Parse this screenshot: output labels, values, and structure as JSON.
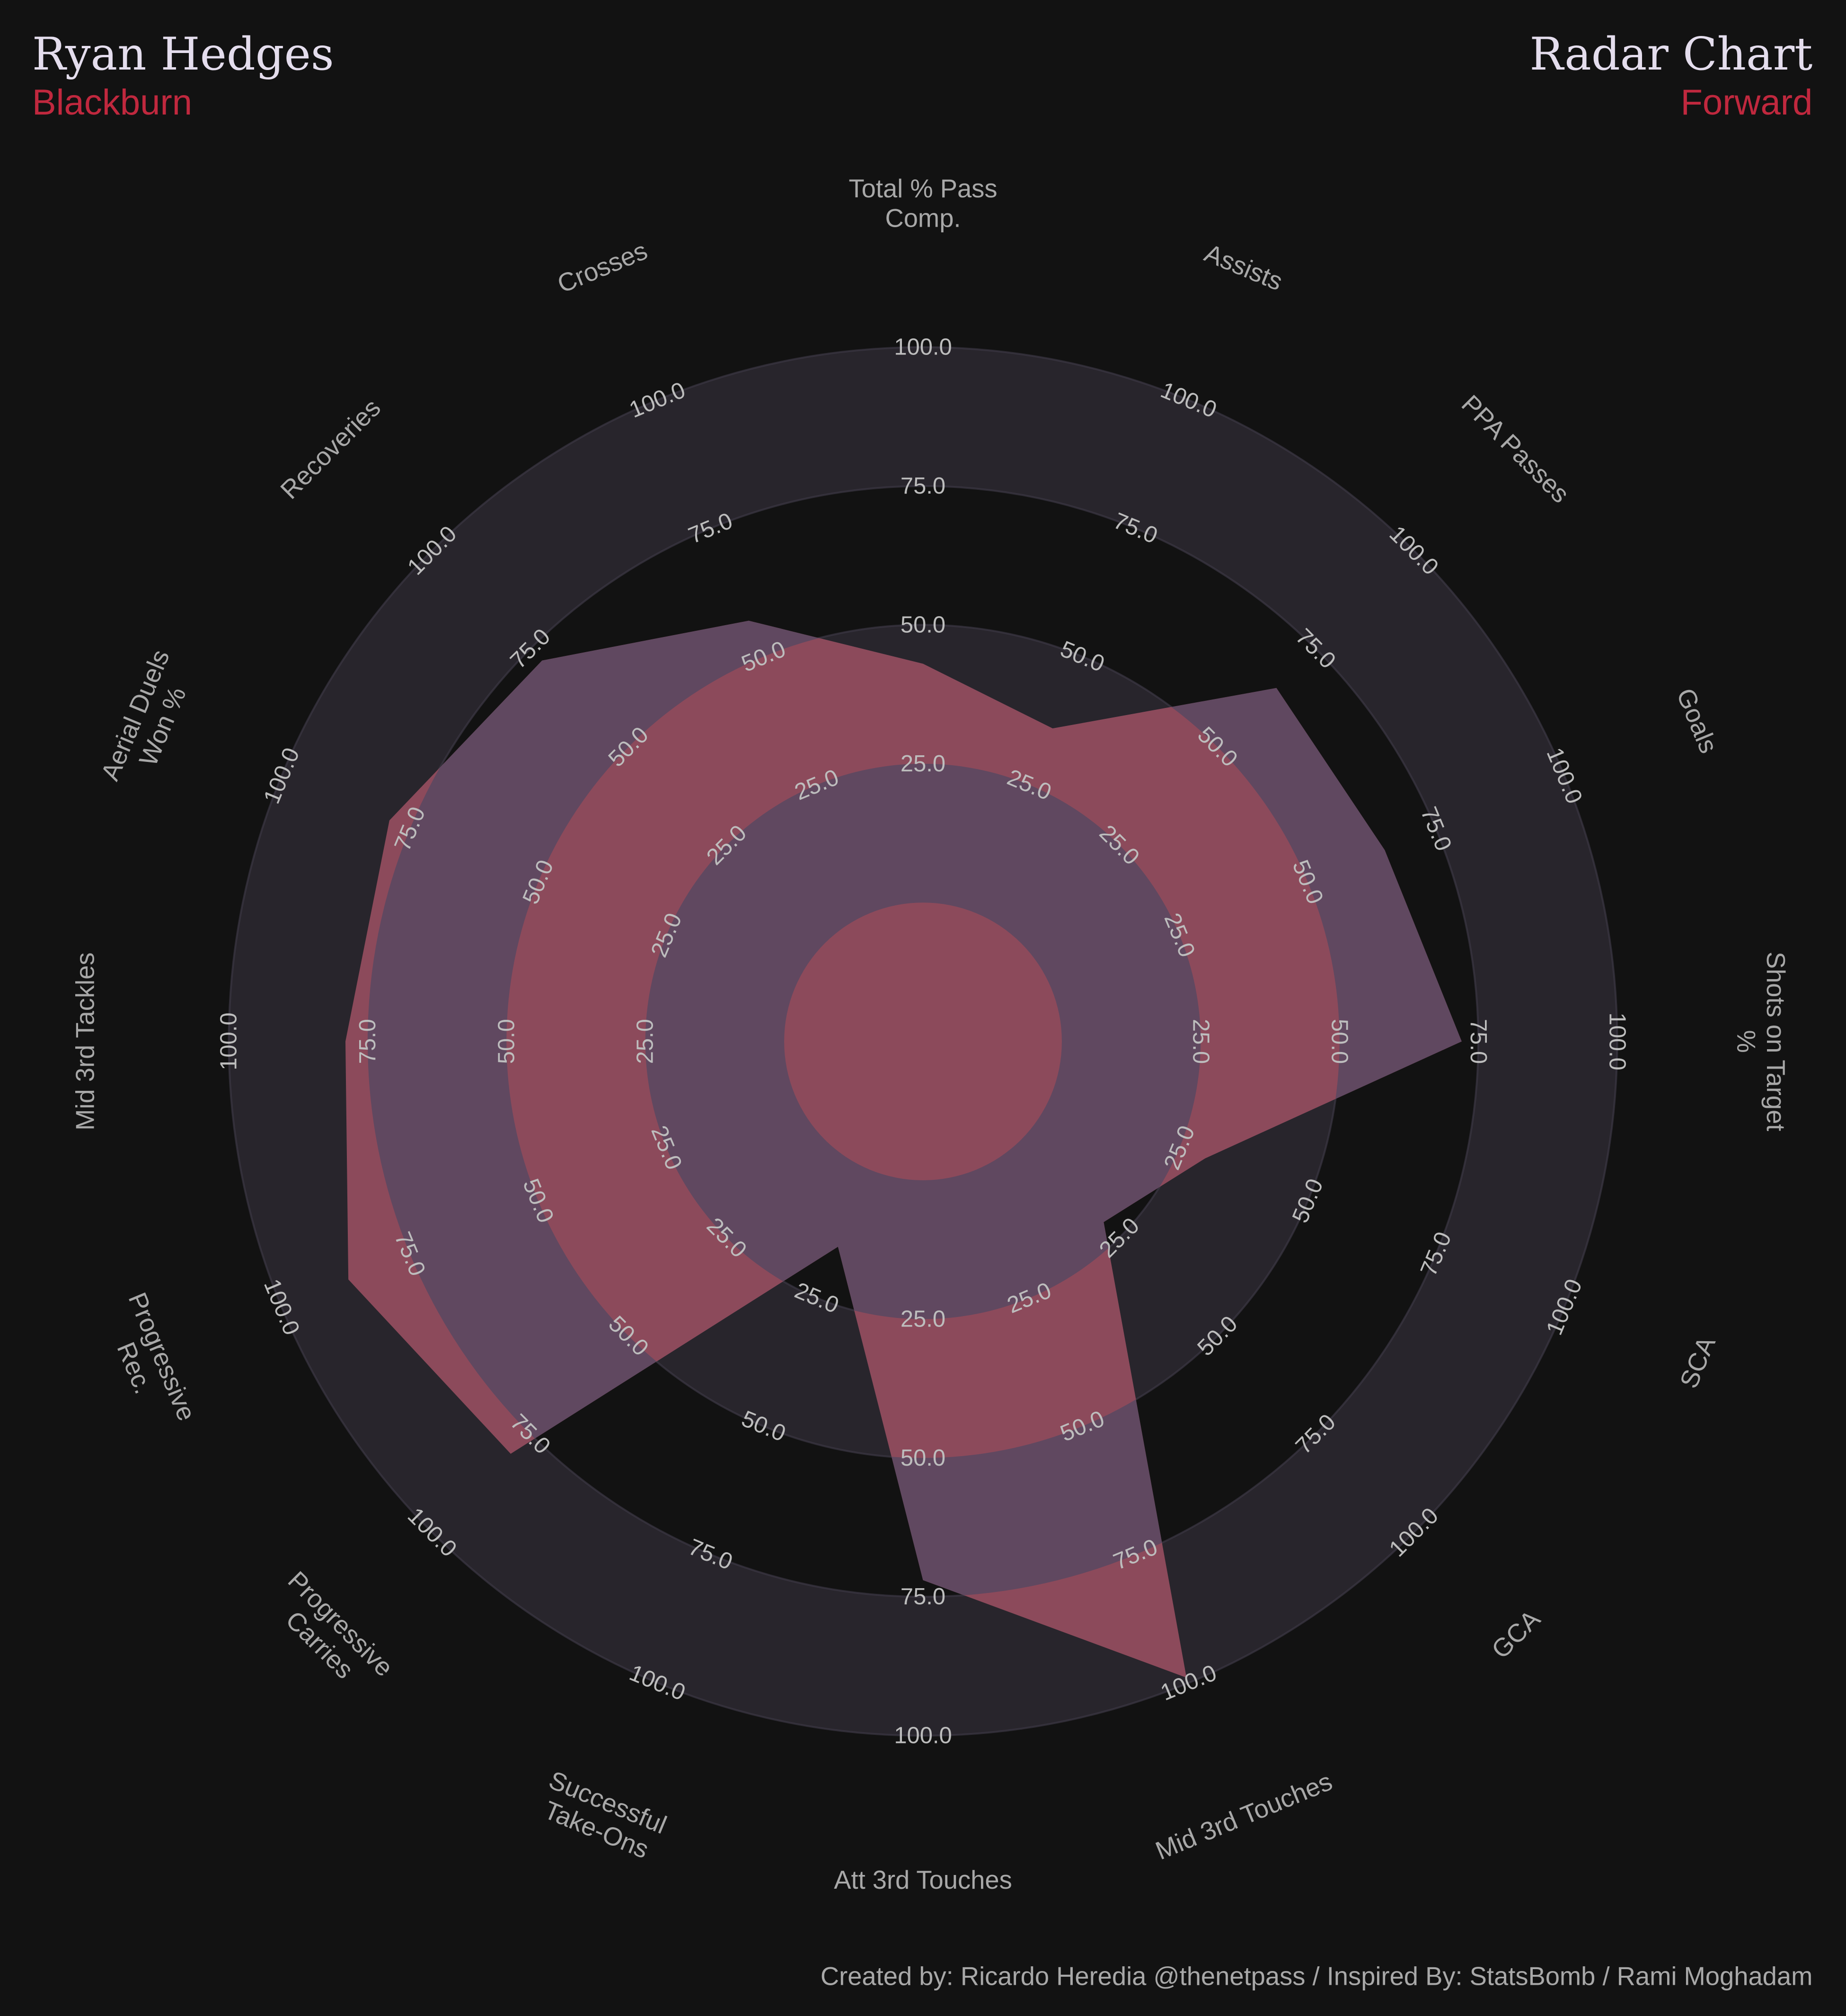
{
  "header": {
    "player": "Ryan Hedges",
    "team": "Blackburn",
    "chart_title": "Radar Chart",
    "position": "Forward"
  },
  "footer": "Created by: Ricardo Heredia @thenetpass / Inspired By: StatsBomb / Rami Moghadam",
  "colors": {
    "background": "#121212",
    "ring": "#28252c",
    "fill_a": "#8c4a5b",
    "fill_b": "#604860",
    "accent": "#c0283e"
  },
  "chart_data": {
    "type": "radar",
    "title": "Radar Chart",
    "params": [
      [
        "Total % Pass",
        "Comp."
      ],
      [
        "Assists"
      ],
      [
        "PPA Passes"
      ],
      [
        "Goals"
      ],
      [
        "Shots on Target",
        "%"
      ],
      [
        "SCA"
      ],
      [
        "GCA"
      ],
      [
        "Mid 3rd Touches"
      ],
      [
        "Att 3rd Touches"
      ],
      [
        "Successful",
        "Take-Ons"
      ],
      [
        "Progressive",
        "Carries"
      ],
      [
        "Progressive",
        "Rec."
      ],
      [
        "Mid 3rd Tackles"
      ],
      [
        "Aerial Duels",
        "Won %"
      ],
      [
        "Recoveries"
      ],
      [
        "Crosses"
      ]
    ],
    "values": [
      43,
      36,
      65,
      65,
      72,
      30,
      21,
      99,
      72,
      15,
      80,
      87,
      79,
      79,
      72,
      57
    ],
    "range": [
      0,
      100
    ],
    "ticks": [
      "25.0",
      "50.0",
      "75.0",
      "100.0"
    ],
    "tick_values": [
      25,
      50,
      75,
      100
    ]
  }
}
